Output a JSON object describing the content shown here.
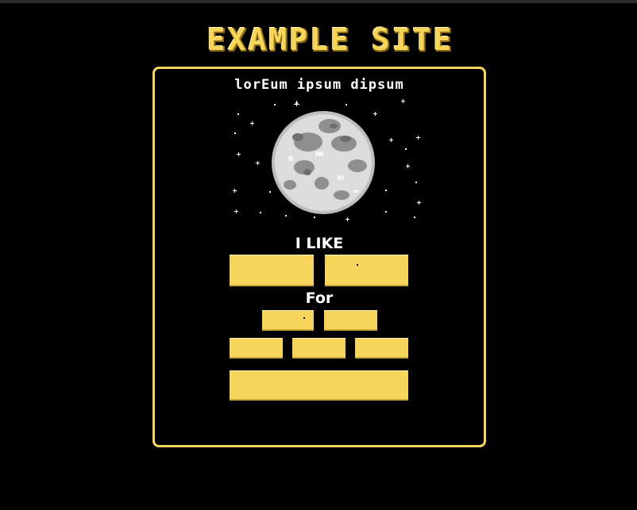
{
  "site": {
    "title": "EXAMPLE SITE"
  },
  "card": {
    "heading": "lorEum ipsum dipsum",
    "moon_image": "full-moon-pixel-art",
    "label_like": "I LIKE",
    "label_for": "For"
  },
  "colors": {
    "accent": "#f7d55a",
    "background": "#000000",
    "text": "#ffffff",
    "moon": "#d9d9d9"
  },
  "buttons": {
    "like_options": [
      {
        "label": ""
      },
      {
        "label": ""
      }
    ],
    "for_row1": [
      {
        "label": ""
      },
      {
        "label": ""
      }
    ],
    "for_row2": [
      {
        "label": ""
      },
      {
        "label": ""
      },
      {
        "label": ""
      }
    ],
    "submit": {
      "label": ""
    }
  }
}
